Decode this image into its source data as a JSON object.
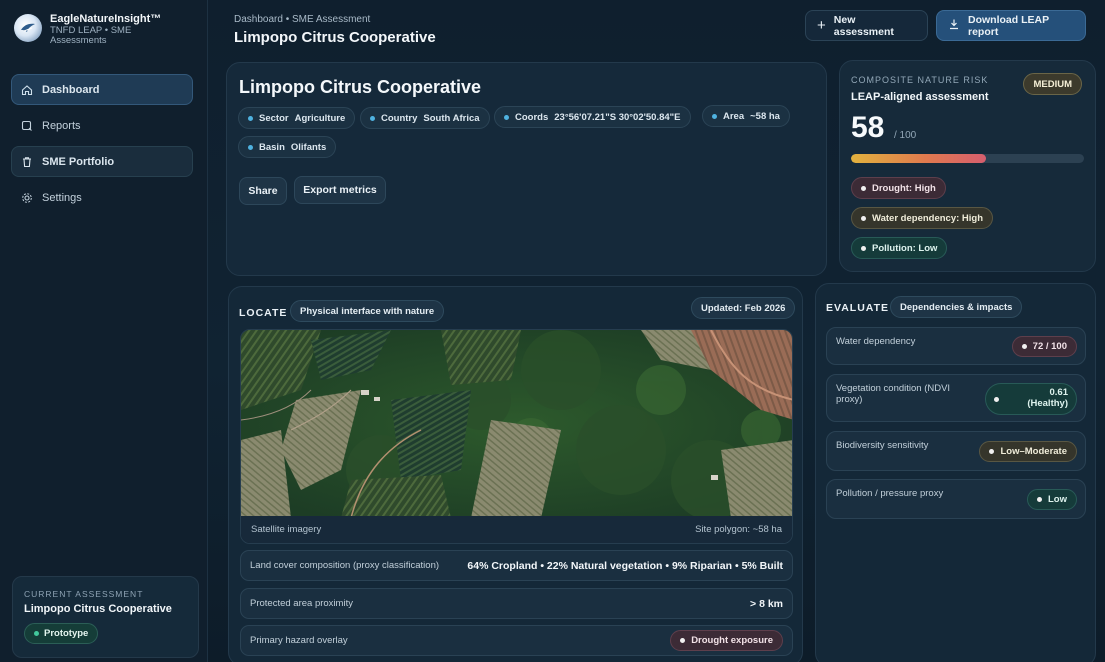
{
  "brand": {
    "name": "EagleNatureInsight™",
    "subtitle": "TNFD LEAP • SME Assessments"
  },
  "sidebar": {
    "items": [
      {
        "label": "Dashboard",
        "icon": "home-icon"
      },
      {
        "label": "Reports",
        "icon": "search-icon"
      },
      {
        "label": "SME Portfolio",
        "icon": "trash-icon"
      },
      {
        "label": "Settings",
        "icon": "gear-icon"
      }
    ],
    "current": {
      "label": "CURRENT ASSESSMENT",
      "name": "Limpopo Citrus Cooperative",
      "status": "Prototype"
    }
  },
  "header": {
    "breadcrumb": "Dashboard • SME Assessment",
    "title": "Limpopo Citrus Cooperative",
    "new_label": "New assessment",
    "download_label": "Download LEAP report"
  },
  "cooperative": {
    "title": "Limpopo Citrus Cooperative",
    "chips": {
      "sector": {
        "key": "Sector",
        "value": "Agriculture"
      },
      "country": {
        "key": "Country",
        "value": "South Africa"
      },
      "coords": {
        "key": "Coords",
        "value": "23°56'07.21\"S 30°02'50.84\"E"
      },
      "area": {
        "key": "Area",
        "value": "~58 ha"
      },
      "basin": {
        "key": "Basin",
        "value": "Olifants"
      }
    },
    "share_label": "Share",
    "export_label": "Export metrics"
  },
  "risk": {
    "label": "COMPOSITE NATURE RISK",
    "subtitle": "LEAP-aligned assessment",
    "badge": "MEDIUM",
    "score": "58",
    "score_of": "/ 100",
    "score_fraction": 0.58,
    "tags": {
      "drought": "Drought: High",
      "water": "Water dependency: High",
      "pollution": "Pollution: Low"
    }
  },
  "locate": {
    "label": "LOCATE",
    "chip": "Physical interface with nature",
    "updated": "Updated: Feb 2026",
    "imagery_label": "Satellite imagery",
    "polygon_label": "Site polygon: ~58 ha",
    "rows": {
      "landcover": {
        "label": "Land cover composition (proxy classification)",
        "value": "64% Cropland • 22% Natural vegetation • 9% Riparian • 5% Built"
      },
      "protected": {
        "label": "Protected area proximity",
        "value": "> 8 km"
      },
      "hazard": {
        "label": "Primary hazard overlay",
        "value": "Drought exposure"
      }
    }
  },
  "evaluate": {
    "label": "EVALUATE",
    "chip": "Dependencies & impacts",
    "rows": {
      "water": {
        "label": "Water dependency",
        "value": "72 / 100"
      },
      "ndvi": {
        "label": "Vegetation condition (NDVI proxy)",
        "value_line1": "0.61",
        "value_line2": "(Healthy)"
      },
      "bio": {
        "label": "Biodiversity sensitivity",
        "value": "Low–Moderate"
      },
      "pollution": {
        "label": "Pollution / pressure proxy",
        "value": "Low"
      }
    }
  },
  "colors": {
    "accent": "#25507a",
    "risk_green": "#42c99c",
    "panel": "#142838"
  }
}
